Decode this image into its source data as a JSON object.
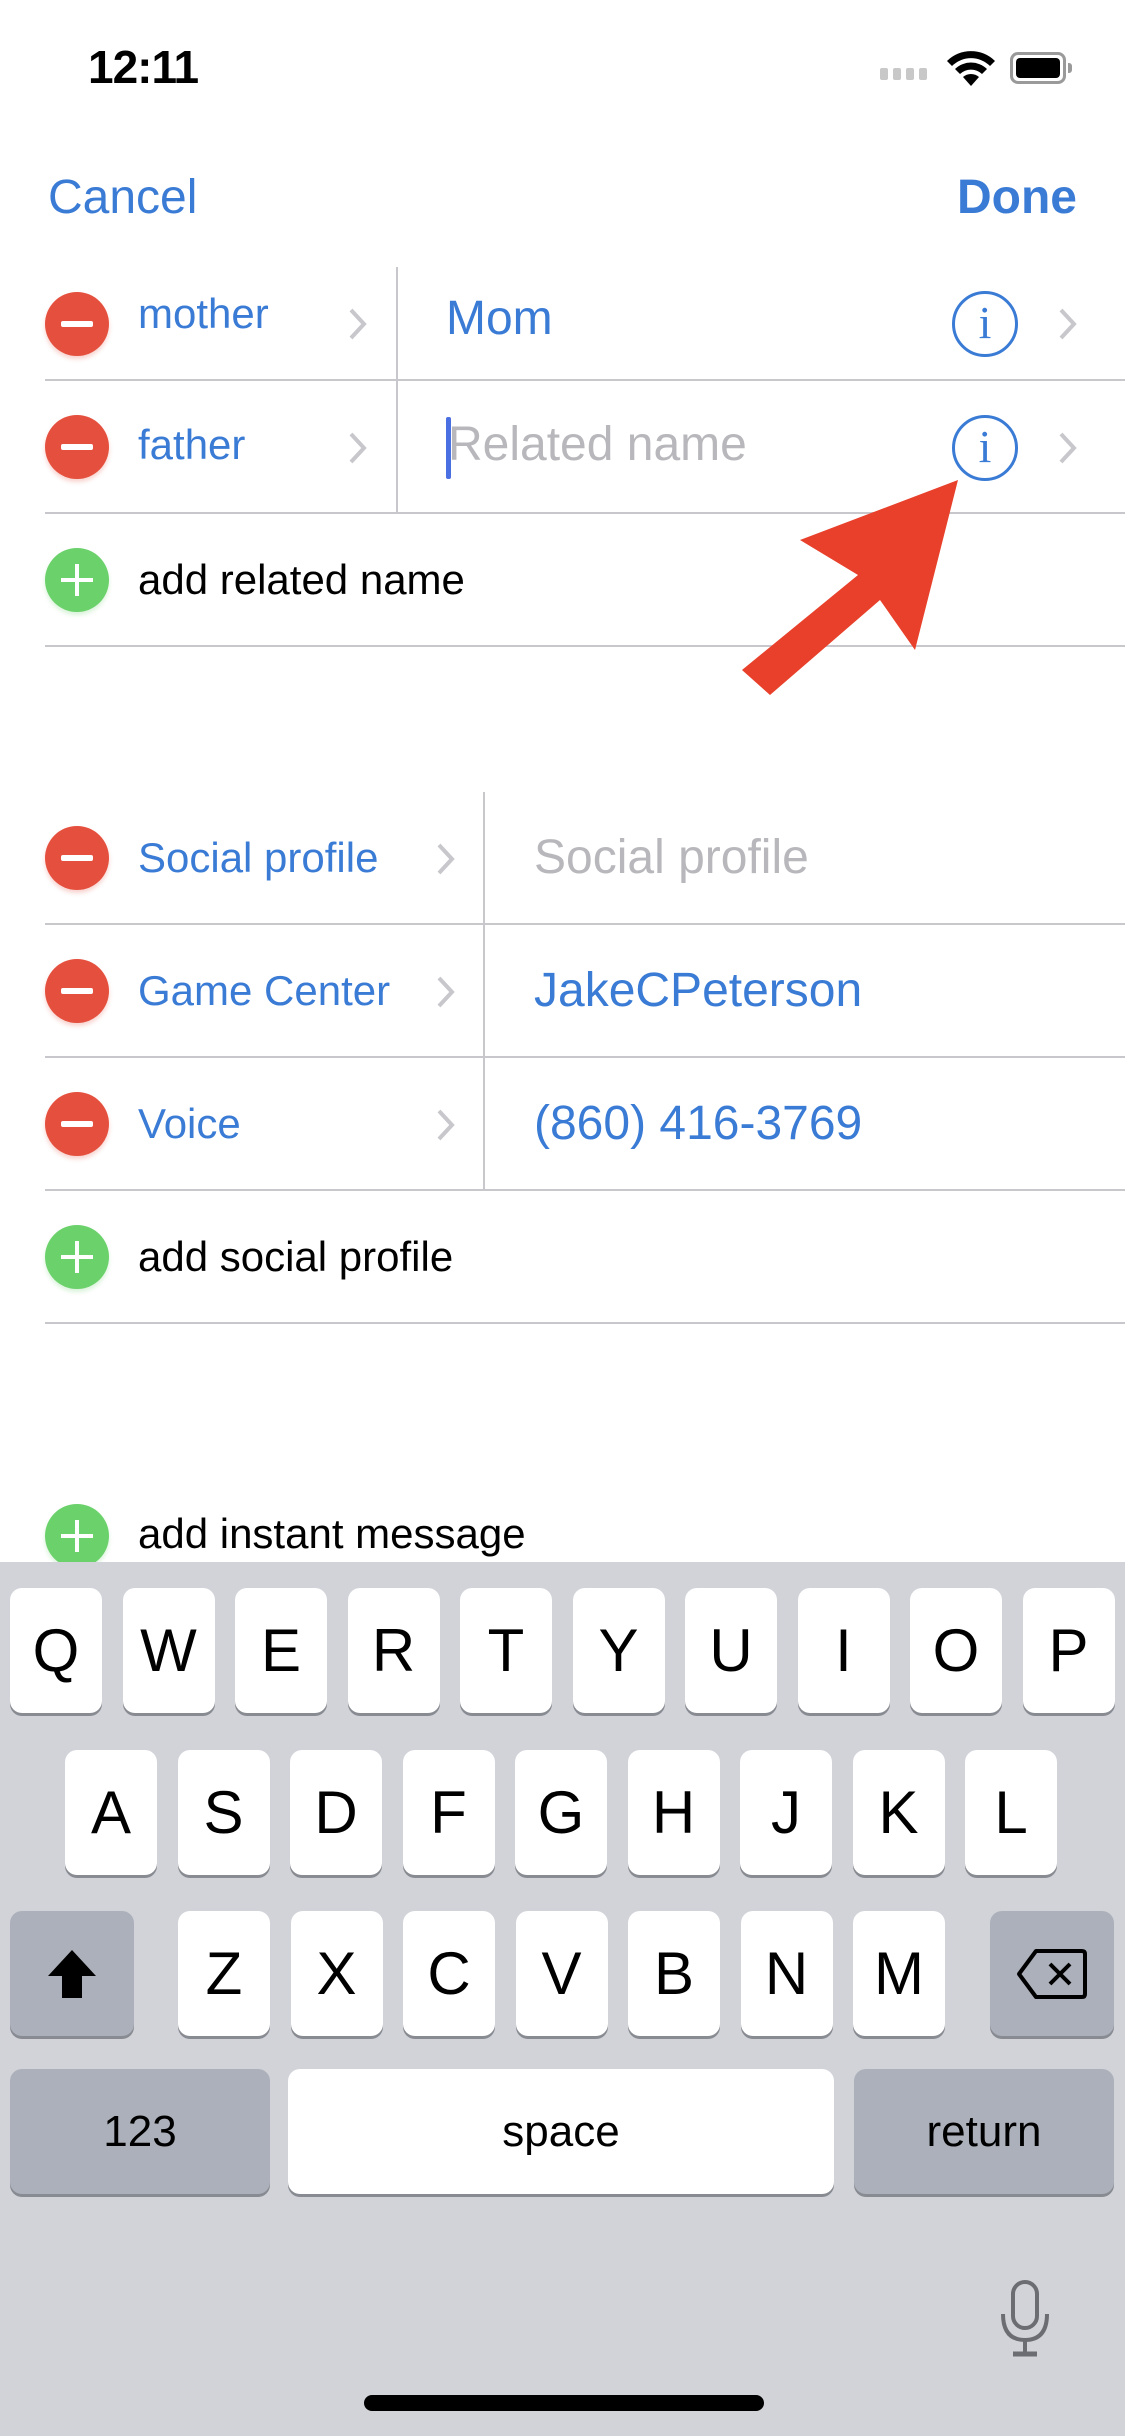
{
  "status_bar": {
    "time": "12:11",
    "icons": [
      "cellular-signal-icon",
      "wifi-icon",
      "battery-icon"
    ]
  },
  "nav": {
    "cancel_label": "Cancel",
    "done_label": "Done"
  },
  "related_names": {
    "rows": [
      {
        "label": "mother",
        "value": "Mom",
        "placeholder": "Related name",
        "is_placeholder": false
      },
      {
        "label": "father",
        "value": "",
        "placeholder": "Related name",
        "is_placeholder": true,
        "focused": true
      }
    ],
    "add_label": "add related name"
  },
  "social_profiles": {
    "rows": [
      {
        "label": "Social profile",
        "value": "",
        "placeholder": "Social profile",
        "is_placeholder": true
      },
      {
        "label": "Game Center",
        "value": "JakeCPeterson",
        "is_placeholder": false
      },
      {
        "label": "Voice",
        "value": "(860) 416-3769",
        "is_placeholder": false
      }
    ],
    "add_label": "add social profile"
  },
  "instant_message": {
    "add_label": "add instant message"
  },
  "keyboard": {
    "row1": [
      "Q",
      "W",
      "E",
      "R",
      "T",
      "Y",
      "U",
      "I",
      "O",
      "P"
    ],
    "row2": [
      "A",
      "S",
      "D",
      "F",
      "G",
      "H",
      "J",
      "K",
      "L"
    ],
    "row3": [
      "Z",
      "X",
      "C",
      "V",
      "B",
      "N",
      "M"
    ],
    "numbers_label": "123",
    "space_label": "space",
    "return_label": "return"
  },
  "colors": {
    "accent_blue": "#3a7bd5",
    "delete_red": "#e5503e",
    "add_green": "#6bd16b",
    "annotation_arrow": "#e8402a",
    "keyboard_bg": "#d1d3d9"
  }
}
